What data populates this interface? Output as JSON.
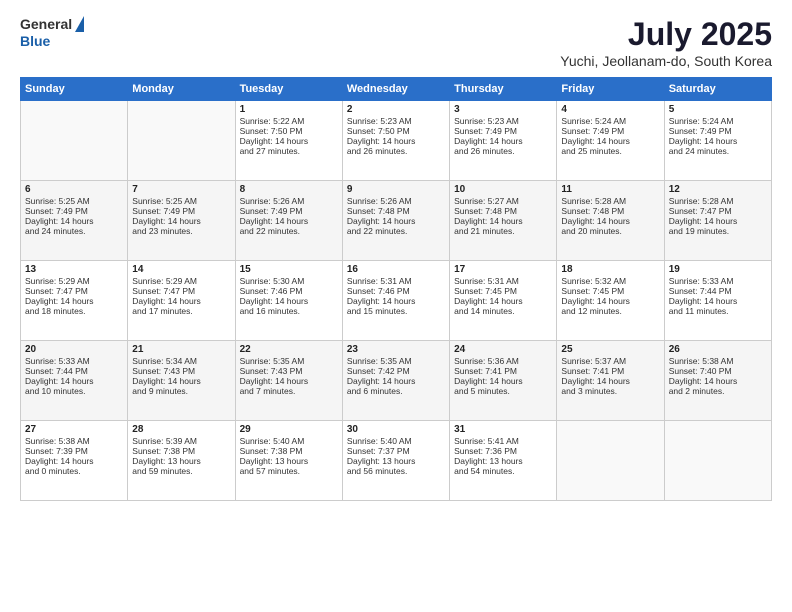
{
  "logo": {
    "line1": "General",
    "line2": "Blue"
  },
  "header": {
    "month": "July 2025",
    "location": "Yuchi, Jeollanam-do, South Korea"
  },
  "weekdays": [
    "Sunday",
    "Monday",
    "Tuesday",
    "Wednesday",
    "Thursday",
    "Friday",
    "Saturday"
  ],
  "weeks": [
    [
      {
        "day": "",
        "content": ""
      },
      {
        "day": "",
        "content": ""
      },
      {
        "day": "1",
        "content": "Sunrise: 5:22 AM\nSunset: 7:50 PM\nDaylight: 14 hours\nand 27 minutes."
      },
      {
        "day": "2",
        "content": "Sunrise: 5:23 AM\nSunset: 7:50 PM\nDaylight: 14 hours\nand 26 minutes."
      },
      {
        "day": "3",
        "content": "Sunrise: 5:23 AM\nSunset: 7:49 PM\nDaylight: 14 hours\nand 26 minutes."
      },
      {
        "day": "4",
        "content": "Sunrise: 5:24 AM\nSunset: 7:49 PM\nDaylight: 14 hours\nand 25 minutes."
      },
      {
        "day": "5",
        "content": "Sunrise: 5:24 AM\nSunset: 7:49 PM\nDaylight: 14 hours\nand 24 minutes."
      }
    ],
    [
      {
        "day": "6",
        "content": "Sunrise: 5:25 AM\nSunset: 7:49 PM\nDaylight: 14 hours\nand 24 minutes."
      },
      {
        "day": "7",
        "content": "Sunrise: 5:25 AM\nSunset: 7:49 PM\nDaylight: 14 hours\nand 23 minutes."
      },
      {
        "day": "8",
        "content": "Sunrise: 5:26 AM\nSunset: 7:49 PM\nDaylight: 14 hours\nand 22 minutes."
      },
      {
        "day": "9",
        "content": "Sunrise: 5:26 AM\nSunset: 7:48 PM\nDaylight: 14 hours\nand 22 minutes."
      },
      {
        "day": "10",
        "content": "Sunrise: 5:27 AM\nSunset: 7:48 PM\nDaylight: 14 hours\nand 21 minutes."
      },
      {
        "day": "11",
        "content": "Sunrise: 5:28 AM\nSunset: 7:48 PM\nDaylight: 14 hours\nand 20 minutes."
      },
      {
        "day": "12",
        "content": "Sunrise: 5:28 AM\nSunset: 7:47 PM\nDaylight: 14 hours\nand 19 minutes."
      }
    ],
    [
      {
        "day": "13",
        "content": "Sunrise: 5:29 AM\nSunset: 7:47 PM\nDaylight: 14 hours\nand 18 minutes."
      },
      {
        "day": "14",
        "content": "Sunrise: 5:29 AM\nSunset: 7:47 PM\nDaylight: 14 hours\nand 17 minutes."
      },
      {
        "day": "15",
        "content": "Sunrise: 5:30 AM\nSunset: 7:46 PM\nDaylight: 14 hours\nand 16 minutes."
      },
      {
        "day": "16",
        "content": "Sunrise: 5:31 AM\nSunset: 7:46 PM\nDaylight: 14 hours\nand 15 minutes."
      },
      {
        "day": "17",
        "content": "Sunrise: 5:31 AM\nSunset: 7:45 PM\nDaylight: 14 hours\nand 14 minutes."
      },
      {
        "day": "18",
        "content": "Sunrise: 5:32 AM\nSunset: 7:45 PM\nDaylight: 14 hours\nand 12 minutes."
      },
      {
        "day": "19",
        "content": "Sunrise: 5:33 AM\nSunset: 7:44 PM\nDaylight: 14 hours\nand 11 minutes."
      }
    ],
    [
      {
        "day": "20",
        "content": "Sunrise: 5:33 AM\nSunset: 7:44 PM\nDaylight: 14 hours\nand 10 minutes."
      },
      {
        "day": "21",
        "content": "Sunrise: 5:34 AM\nSunset: 7:43 PM\nDaylight: 14 hours\nand 9 minutes."
      },
      {
        "day": "22",
        "content": "Sunrise: 5:35 AM\nSunset: 7:43 PM\nDaylight: 14 hours\nand 7 minutes."
      },
      {
        "day": "23",
        "content": "Sunrise: 5:35 AM\nSunset: 7:42 PM\nDaylight: 14 hours\nand 6 minutes."
      },
      {
        "day": "24",
        "content": "Sunrise: 5:36 AM\nSunset: 7:41 PM\nDaylight: 14 hours\nand 5 minutes."
      },
      {
        "day": "25",
        "content": "Sunrise: 5:37 AM\nSunset: 7:41 PM\nDaylight: 14 hours\nand 3 minutes."
      },
      {
        "day": "26",
        "content": "Sunrise: 5:38 AM\nSunset: 7:40 PM\nDaylight: 14 hours\nand 2 minutes."
      }
    ],
    [
      {
        "day": "27",
        "content": "Sunrise: 5:38 AM\nSunset: 7:39 PM\nDaylight: 14 hours\nand 0 minutes."
      },
      {
        "day": "28",
        "content": "Sunrise: 5:39 AM\nSunset: 7:38 PM\nDaylight: 13 hours\nand 59 minutes."
      },
      {
        "day": "29",
        "content": "Sunrise: 5:40 AM\nSunset: 7:38 PM\nDaylight: 13 hours\nand 57 minutes."
      },
      {
        "day": "30",
        "content": "Sunrise: 5:40 AM\nSunset: 7:37 PM\nDaylight: 13 hours\nand 56 minutes."
      },
      {
        "day": "31",
        "content": "Sunrise: 5:41 AM\nSunset: 7:36 PM\nDaylight: 13 hours\nand 54 minutes."
      },
      {
        "day": "",
        "content": ""
      },
      {
        "day": "",
        "content": ""
      }
    ]
  ]
}
